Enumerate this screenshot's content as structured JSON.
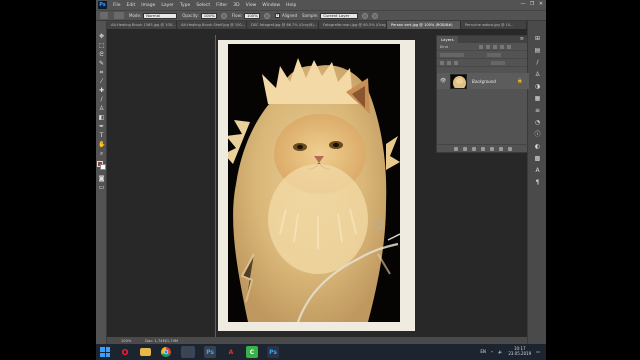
{
  "app": {
    "logo": "Ps",
    "menu": [
      "File",
      "Edit",
      "Image",
      "Layer",
      "Type",
      "Select",
      "Filter",
      "3D",
      "View",
      "Window",
      "Help"
    ],
    "window_controls": [
      "—",
      "❐",
      "✕"
    ]
  },
  "options_bar": {
    "tool_icon": "clone-stamp-icon",
    "mode_label": "Mode:",
    "mode_value": "Normal",
    "opacity_label": "Opacity:",
    "opacity_value": "100%",
    "flow_label": "Flow:",
    "flow_value": "100%",
    "aligned_label": "Aligned",
    "aligned_checked": true,
    "sample_label": "Sample:",
    "sample_value": "Current Layer"
  },
  "document_tabs": [
    {
      "label": "Alt-Healing Brush 1565.jpg @ 100...",
      "active": false
    },
    {
      "label": "Alt-Healing Brush Shelf.jpg @ 100...",
      "active": false
    },
    {
      "label": "DSC fotograf.jpg @ 66.7% (Gray/8)...",
      "active": false
    },
    {
      "label": "Fotografie-mari.jpg @ 60.5% (Gray/8)...",
      "active": false
    },
    {
      "label": "Persan vert.jpg @ 100% (RGB/8#)",
      "active": true
    },
    {
      "label": "Perruche wabro.jpg @ 10...",
      "active": false
    }
  ],
  "layers_panel": {
    "tab": "Layers",
    "filter_label": "Kind",
    "layer_name": "Background",
    "layer_locked": true
  },
  "status_bar": {
    "zoom": "100%",
    "doc_info": "Doc: 1,74M/1,74M"
  },
  "taskbar": {
    "apps": [
      "windows-start",
      "opera",
      "file-explorer",
      "chrome",
      "photoshop-taskview",
      "photoshop",
      "acrobat",
      "camtasia",
      "photoshop-alt"
    ],
    "language": "EN",
    "time": "10:17",
    "date": "23.05.2019"
  },
  "colors": {
    "workspace": "#535353",
    "document_bg": "#282828",
    "photo_bg": "#050403",
    "fur": "#e8c98a",
    "taskbar": "#1c2430"
  }
}
